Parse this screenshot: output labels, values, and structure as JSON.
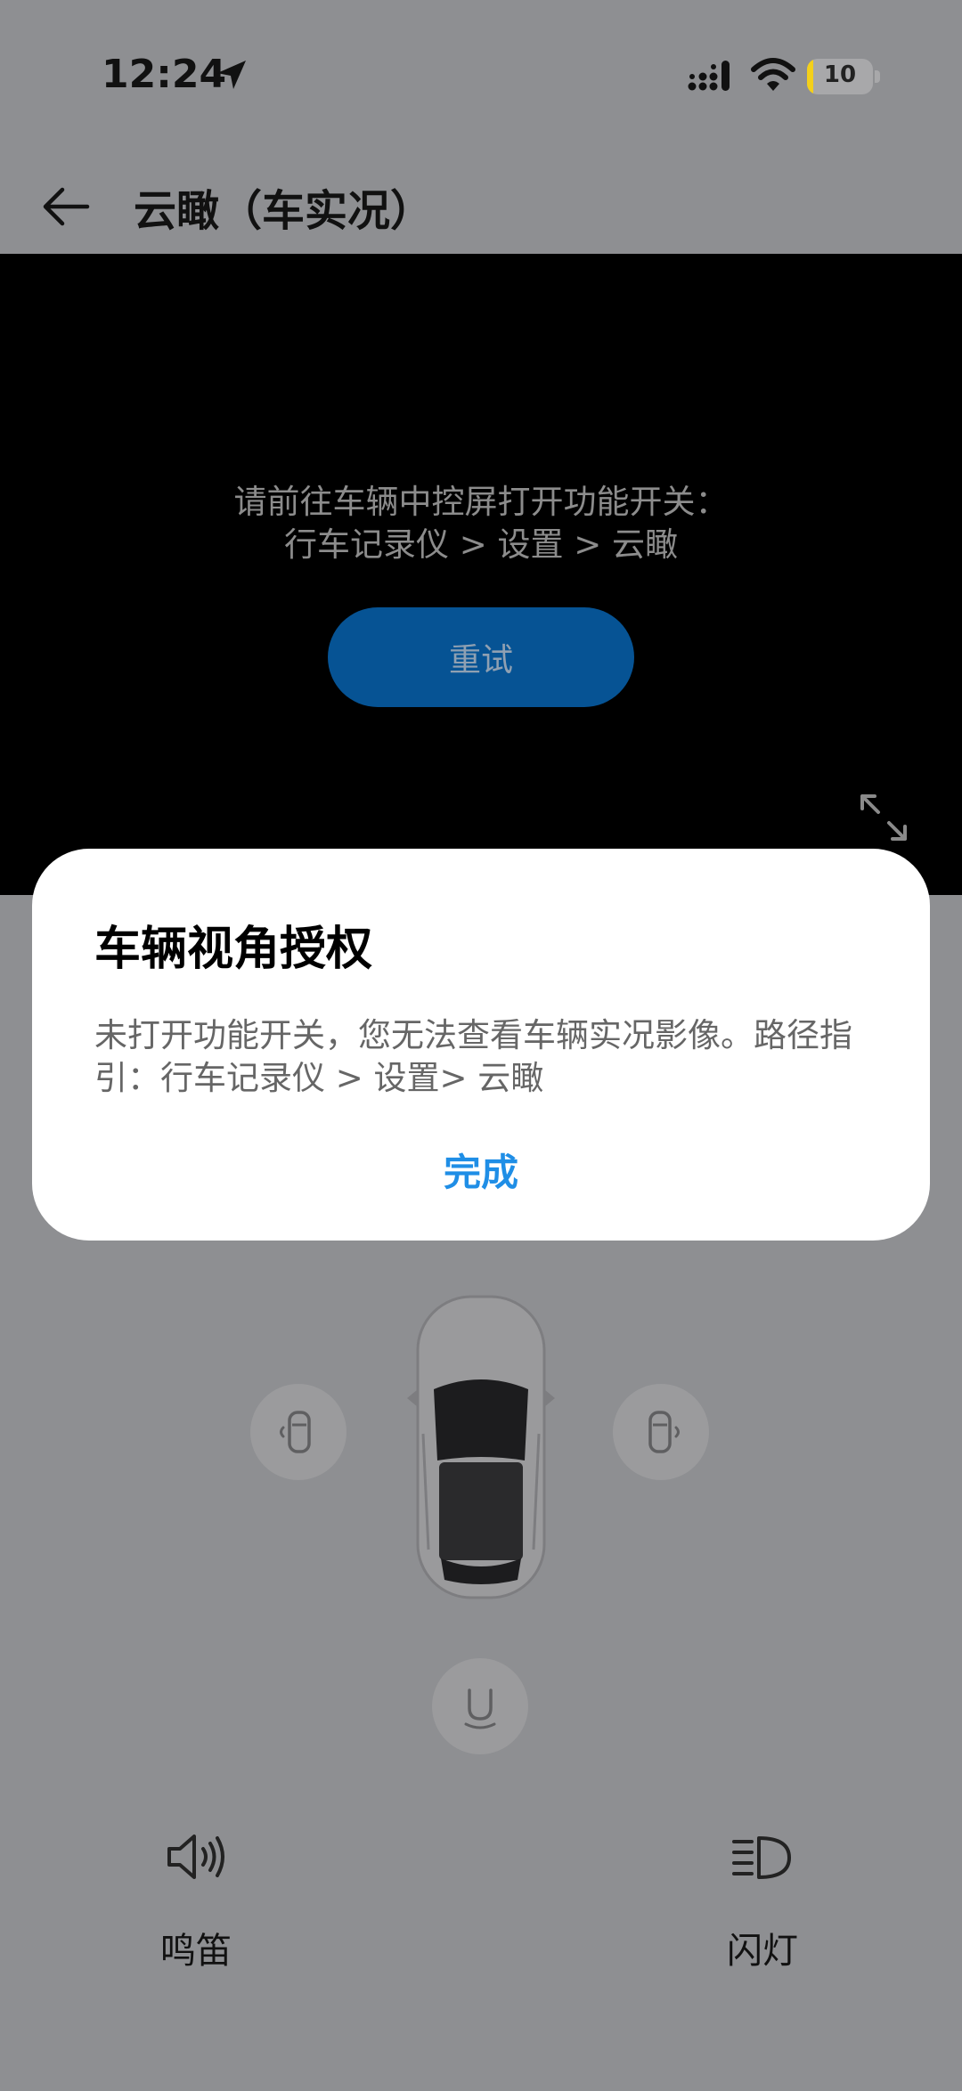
{
  "status_bar": {
    "time": "12:24",
    "battery": "10",
    "battery_fraction": 0.1,
    "icons": [
      "location-arrow-icon",
      "signal-icon",
      "wifi-icon",
      "battery-charging-icon"
    ]
  },
  "nav": {
    "title": "云瞰（车实况）",
    "back_icon": "arrow-left-icon"
  },
  "video": {
    "message_line1": "请前往车辆中控屏打开功能开关：",
    "message_line2": "行车记录仪 > 设置 > 云瞰",
    "retry_label": "重试",
    "expand_icon": "fullscreen-expand-icon"
  },
  "dialog": {
    "title": "车辆视角授权",
    "body": "未打开功能开关，您无法查看车辆实况影像。路径指引：行车记录仪 > 设置> 云瞰",
    "done_label": "完成"
  },
  "car_controls": {
    "icons": [
      "left-side-view-icon",
      "right-side-view-icon",
      "rear-view-icon",
      "car-top-view-image"
    ]
  },
  "actions": [
    {
      "label": "鸣笛",
      "icon": "horn-speaker-icon"
    },
    {
      "label": "闪灯",
      "icon": "headlight-icon"
    }
  ],
  "colors": {
    "overlay_bg": "#8e8f92",
    "video_bg": "#000000",
    "retry_button": "#065394",
    "dialog_action": "#1f8ee6",
    "battery_fill": "#f4d01a"
  }
}
